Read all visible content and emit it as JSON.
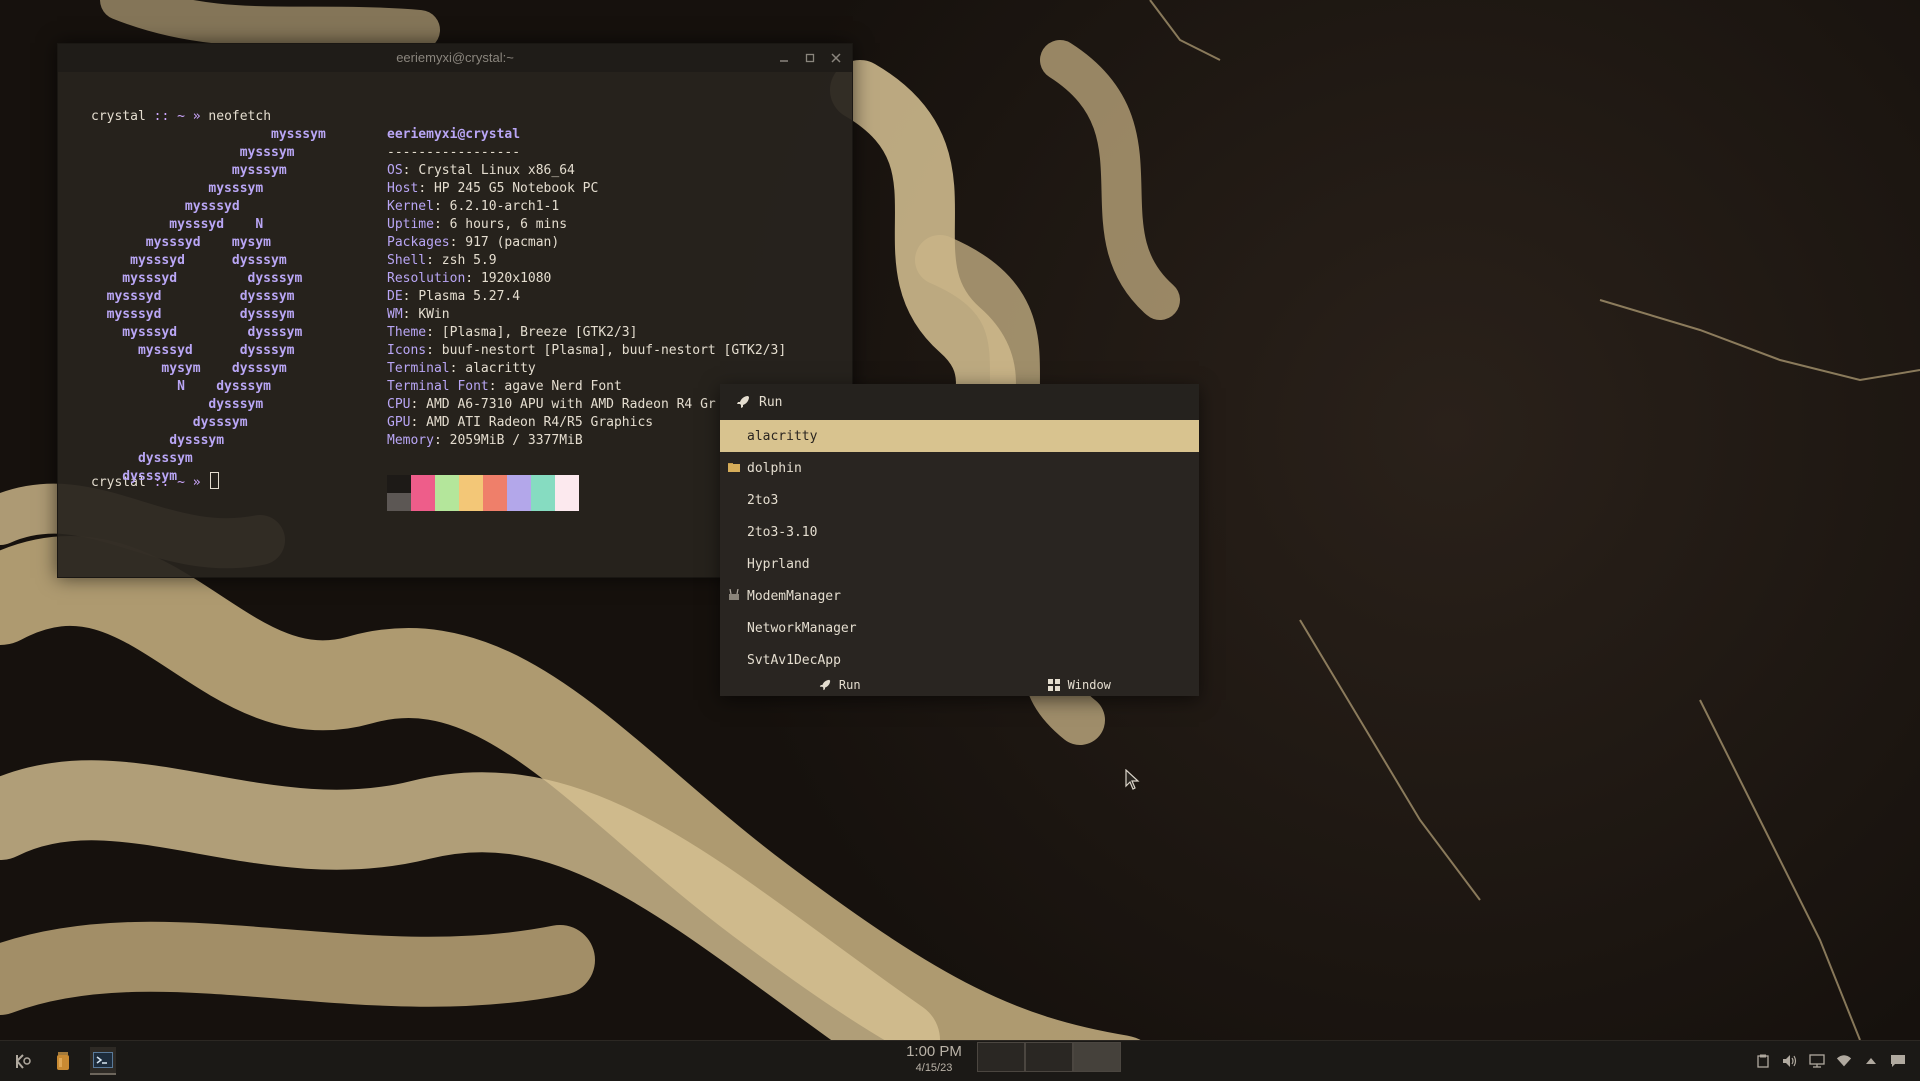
{
  "terminal": {
    "title": "eeriemyxi@crystal:~",
    "prompt_host": "crystal",
    "prompt_sep": " :: ~ » ",
    "command": "neofetch",
    "logo_lines": [
      "           mysssym",
      "         mysssym",
      "        mysssym",
      "      mysssym",
      "    mysssyd",
      "   mysssyd    N",
      " mysssyd    mysym",
      "mysssyd      dysssym",
      "mysssyd         dysssym",
      "mysssyd          dysssym",
      "mysssyd          dysssym",
      "mysssyd         dysssym",
      " mysssyd      dysssym",
      "   mysym    dysssym",
      "    N    dysssym",
      "      dysssym",
      "    dysssym",
      "  dysssym",
      "dysssym",
      "dysssym"
    ],
    "logo_indents": [
      12,
      10,
      10,
      9,
      8,
      7,
      6,
      5,
      4,
      2,
      2,
      4,
      5,
      6,
      7,
      9,
      9,
      8,
      6,
      4
    ],
    "user_host": "eeriemyxi@crystal",
    "separator": "-----------------",
    "info": [
      {
        "key": "OS",
        "value": "Crystal Linux x86_64"
      },
      {
        "key": "Host",
        "value": "HP 245 G5 Notebook PC"
      },
      {
        "key": "Kernel",
        "value": "6.2.10-arch1-1"
      },
      {
        "key": "Uptime",
        "value": "6 hours, 6 mins"
      },
      {
        "key": "Packages",
        "value": "917 (pacman)"
      },
      {
        "key": "Shell",
        "value": "zsh 5.9"
      },
      {
        "key": "Resolution",
        "value": "1920x1080"
      },
      {
        "key": "DE",
        "value": "Plasma 5.27.4"
      },
      {
        "key": "WM",
        "value": "KWin"
      },
      {
        "key": "Theme",
        "value": "[Plasma], Breeze [GTK2/3]"
      },
      {
        "key": "Icons",
        "value": "buuf-nestort [Plasma], buuf-nestort [GTK2/3]"
      },
      {
        "key": "Terminal",
        "value": "alacritty"
      },
      {
        "key": "Terminal Font",
        "value": "agave Nerd Font"
      },
      {
        "key": "CPU",
        "value": "AMD A6-7310 APU with AMD Radeon R4 Gr"
      },
      {
        "key": "GPU",
        "value": "AMD ATI Radeon R4/R5 Graphics"
      },
      {
        "key": "Memory",
        "value": "2059MiB / 3377MiB"
      }
    ],
    "palette_top": [
      "#1d1a17",
      "#ee5d8a",
      "#b4e69b",
      "#f3c777",
      "#ef7f6a",
      "#b3a7ea",
      "#86dcc1",
      "#fce9ee"
    ],
    "palette_bottom": [
      "#5c5754",
      "#ee5d8a",
      "#b4e69b",
      "#f3c777",
      "#ef7f6a",
      "#b3a7ea",
      "#86dcc1",
      "#fce9ee"
    ]
  },
  "krunner": {
    "query_label": "Run",
    "items": [
      {
        "label": "alacritty",
        "icon": "none",
        "selected": true
      },
      {
        "label": "dolphin",
        "icon": "folder-icon"
      },
      {
        "label": "2to3",
        "icon": "none"
      },
      {
        "label": "2to3-3.10",
        "icon": "none"
      },
      {
        "label": "Hyprland",
        "icon": "none"
      },
      {
        "label": "ModemManager",
        "icon": "modem-icon"
      },
      {
        "label": "NetworkManager",
        "icon": "none"
      },
      {
        "label": "SvtAv1DecApp",
        "icon": "none"
      }
    ],
    "footer": {
      "run_label": "Run",
      "window_label": "Window"
    }
  },
  "taskbar": {
    "time": "1:00 PM",
    "date": "4/15/23",
    "desktops": 3,
    "current_desktop": 3
  },
  "colors": {
    "accent": "#d8c38f",
    "logo": "#b9a6f5",
    "panel": "#1b1916"
  }
}
